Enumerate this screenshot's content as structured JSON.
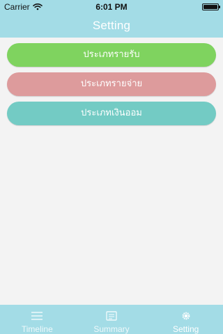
{
  "status_bar": {
    "carrier": "Carrier",
    "time": "6:01 PM"
  },
  "navigation": {
    "title": "Setting"
  },
  "categories": [
    {
      "label": "ประเภทรายรับ",
      "color": "#7fd35f"
    },
    {
      "label": "ประเภทรายจ่าย",
      "color": "#dd9b9c"
    },
    {
      "label": "ประเภทเงินออม",
      "color": "#73cbc4"
    }
  ],
  "tabs": [
    {
      "label": "Timeline",
      "icon": "timeline-icon",
      "selected": false
    },
    {
      "label": "Summary",
      "icon": "summary-icon",
      "selected": false
    },
    {
      "label": "Setting",
      "icon": "settings-icon",
      "selected": true
    }
  ],
  "colors": {
    "header": "#a3dce6",
    "background": "#f3f3f3"
  }
}
